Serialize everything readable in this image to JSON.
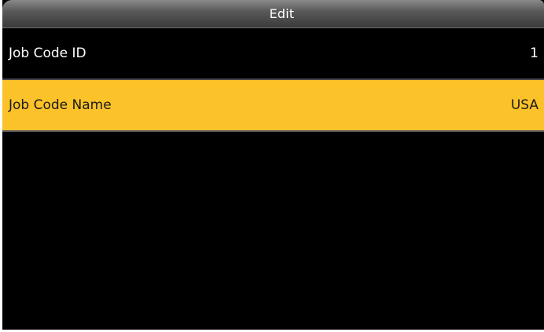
{
  "header": {
    "title": "Edit"
  },
  "fields": [
    {
      "label": "Job Code ID",
      "value": "1"
    },
    {
      "label": "Job Code Name",
      "value": "USA"
    }
  ],
  "colors": {
    "highlight": "#fbc229",
    "background": "#000000",
    "text": "#ffffff"
  }
}
